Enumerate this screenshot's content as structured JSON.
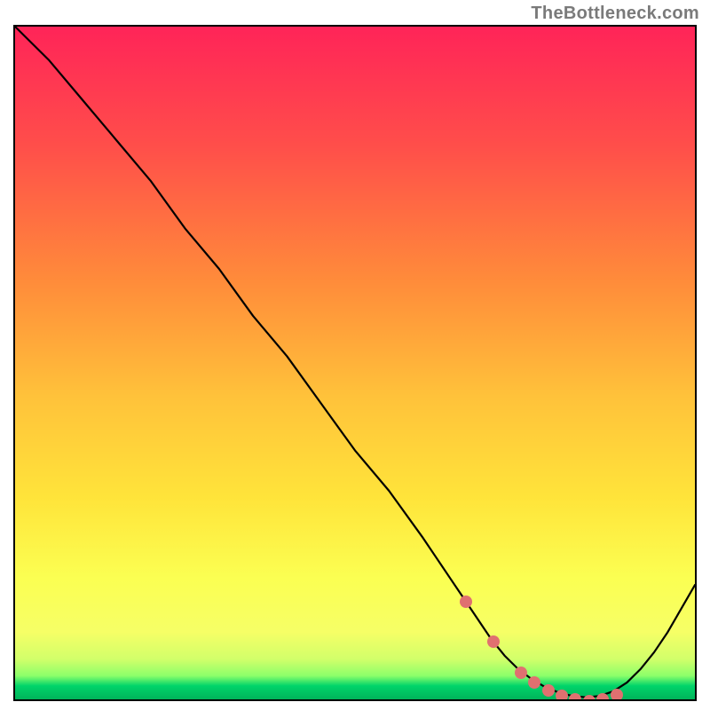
{
  "watermark": "TheBottleneck.com",
  "colors": {
    "gradient_top": "#ff2458",
    "gradient_mid_upper": "#ff8c3a",
    "gradient_mid": "#ffe43a",
    "gradient_mid_lower": "#f6ff66",
    "gradient_green": "#00d46a",
    "curve": "#000000",
    "marker": "#e07070",
    "border": "#000000"
  },
  "chart_data": {
    "type": "line",
    "title": "",
    "xlabel": "",
    "ylabel": "",
    "xlim": [
      0,
      100
    ],
    "ylim": [
      0,
      100
    ],
    "series": [
      {
        "name": "bottleneck-curve",
        "x": [
          0,
          5,
          10,
          15,
          20,
          25,
          30,
          35,
          40,
          45,
          50,
          55,
          60,
          62,
          64,
          66,
          68,
          70,
          72,
          74,
          76,
          78,
          80,
          82,
          84,
          86,
          88,
          90,
          92,
          94,
          96,
          98,
          100
        ],
        "y": [
          100,
          95,
          89,
          83,
          77,
          70,
          64,
          57,
          51,
          44,
          37,
          31,
          24,
          21,
          18,
          15,
          12,
          9,
          6.5,
          4.5,
          3,
          1.8,
          1,
          0.5,
          0.3,
          0.5,
          1.2,
          2.5,
          4.5,
          7,
          10,
          13.5,
          17
        ]
      }
    ],
    "markers": {
      "name": "highlighted-points",
      "x": [
        66,
        70,
        74,
        76,
        78,
        80,
        82,
        84,
        86,
        88
      ],
      "y": [
        15,
        9,
        4.5,
        3,
        1.8,
        1,
        0.5,
        0.3,
        0.5,
        1.2
      ]
    }
  }
}
